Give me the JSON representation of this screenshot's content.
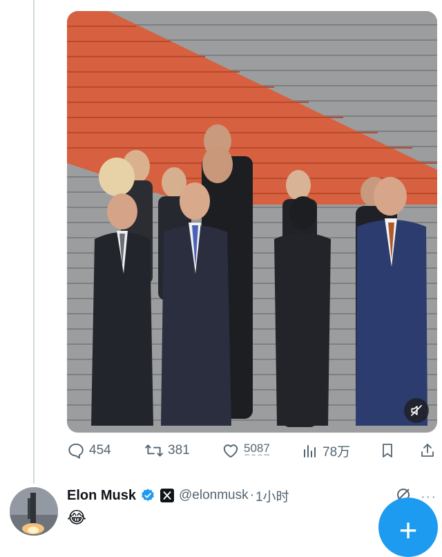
{
  "tweet_actions": {
    "replies": "454",
    "reposts": "381",
    "likes": "5087",
    "likes_rolling": "5087",
    "views": "78万"
  },
  "next_tweet": {
    "display_name": "Elon Musk",
    "handle": "@elonmusk",
    "separator": "·",
    "time": "1小时",
    "body": "😂",
    "more": "···"
  },
  "colors": {
    "accent": "#1d9bf0",
    "icon_gray": "#536471",
    "stairs_red": "#d6603f",
    "verified_blue": "#1d9bf0"
  },
  "icons": [
    "reply-icon",
    "repost-icon",
    "like-icon",
    "views-icon",
    "bookmark-icon",
    "share-icon",
    "mute-icon",
    "verified-badge-icon",
    "x-affiliate-icon",
    "grok-icon",
    "compose-icon"
  ]
}
